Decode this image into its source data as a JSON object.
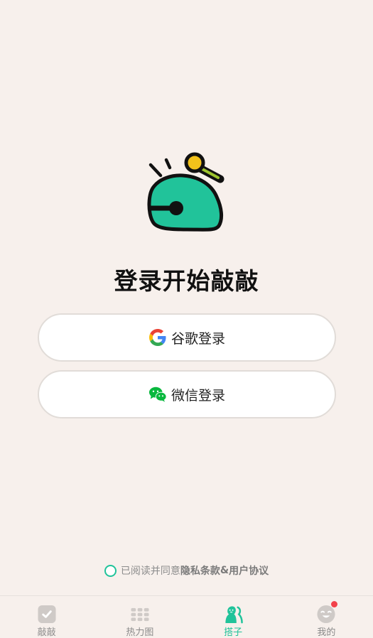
{
  "title": "登录开始敲敲",
  "login_buttons": {
    "google_label": "谷歌登录",
    "wechat_label": "微信登录"
  },
  "agreement": {
    "prefix": "已阅读并同意",
    "privacy": "隐私条款",
    "amp": "&",
    "user_agreement": "用户协议"
  },
  "tabs": [
    {
      "label": "敲敲",
      "icon": "check-square-icon"
    },
    {
      "label": "热力图",
      "icon": "grid-icon"
    },
    {
      "label": "搭子",
      "icon": "buddy-icon",
      "active": true
    },
    {
      "label": "我的",
      "icon": "smiley-icon",
      "badge": true
    }
  ],
  "colors": {
    "accent": "#21c39a",
    "background": "#f7f0ec",
    "badge": "#f2414a"
  }
}
